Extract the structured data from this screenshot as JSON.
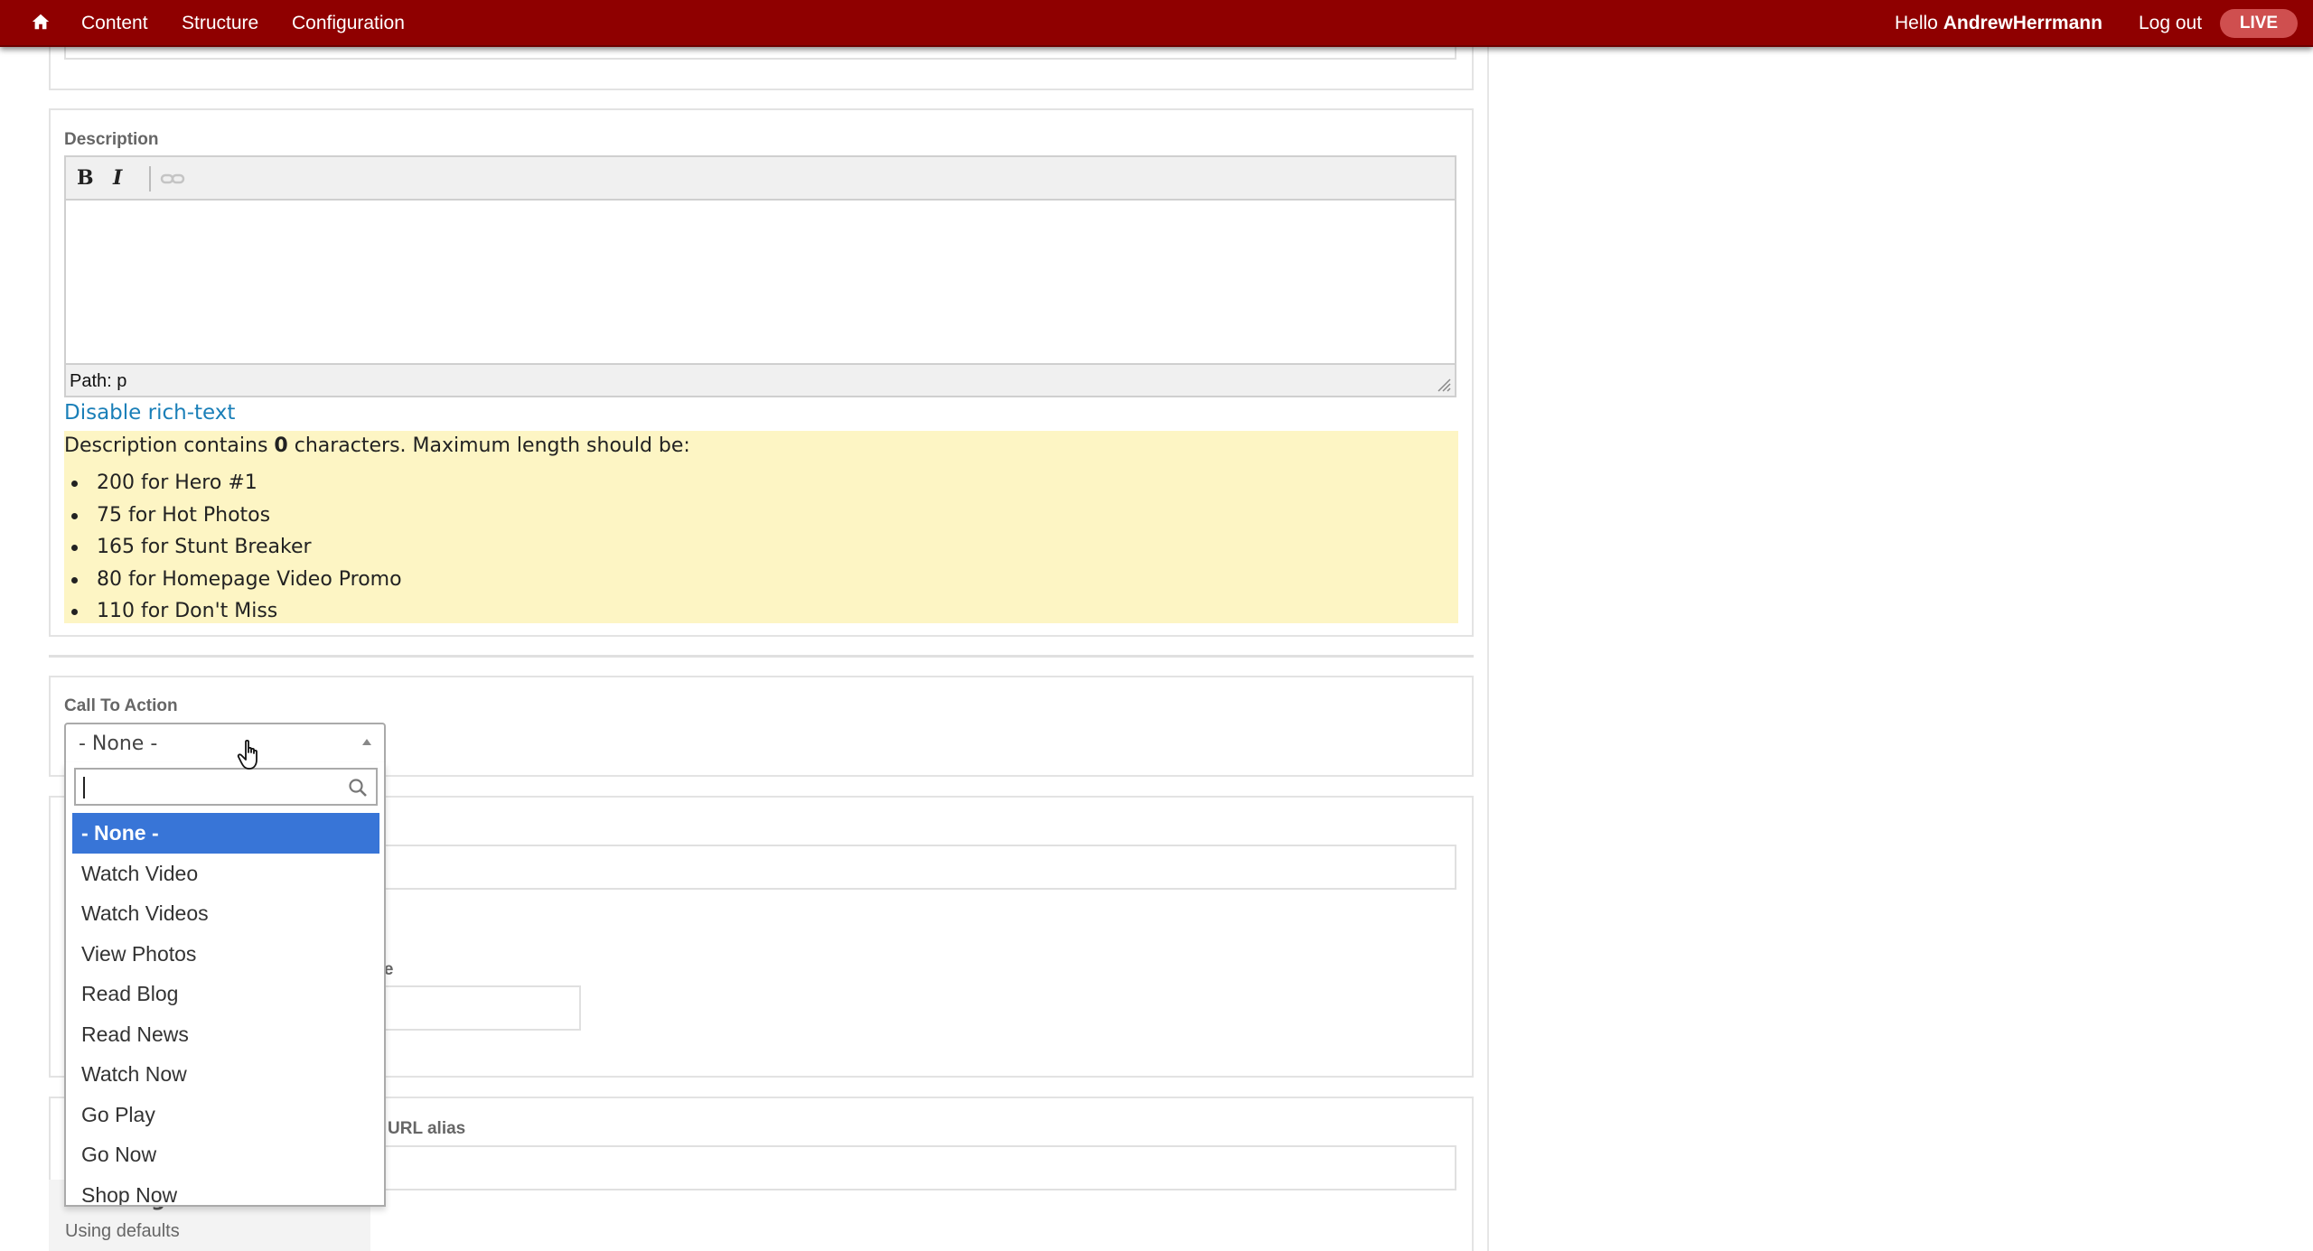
{
  "topbar": {
    "nav": [
      "Content",
      "Structure",
      "Configuration"
    ],
    "greeting": "Hello",
    "username": "AndrewHerrmann",
    "logout": "Log out",
    "environment": "LIVE"
  },
  "description_field": {
    "label": "Description",
    "toolbar": {
      "bold": "B",
      "italic": "I"
    },
    "path": "Path: p",
    "disable_link": "Disable rich-text",
    "notice": {
      "prefix": "Description contains ",
      "count": "0",
      "suffix": " characters. Maximum length should be:",
      "items": [
        "200 for Hero #1",
        "75 for Hot Photos",
        "165 for Stunt Breaker",
        "80 for Homepage Video Promo",
        "110 for Don't Miss"
      ]
    }
  },
  "cta_field": {
    "label": "Call To Action",
    "selected": "- None -",
    "options": [
      "- None -",
      "Watch Video",
      "Watch Videos",
      "View Photos",
      "Read Blog",
      "Read News",
      "Watch Now",
      "Go Play",
      "Go Now",
      "Shop Now"
    ]
  },
  "partial_labels": {
    "name_suffix": "me",
    "url_alias": "URL alias"
  },
  "meta_tags": {
    "title": "Meta tags",
    "subtitle": "Using defaults"
  },
  "colors": {
    "topbar": "#8f0000",
    "live_badge": "#cf4f4f",
    "link": "#1a7fb8",
    "notice_bg": "#fdf5c4",
    "selected_option": "#3875d7"
  }
}
